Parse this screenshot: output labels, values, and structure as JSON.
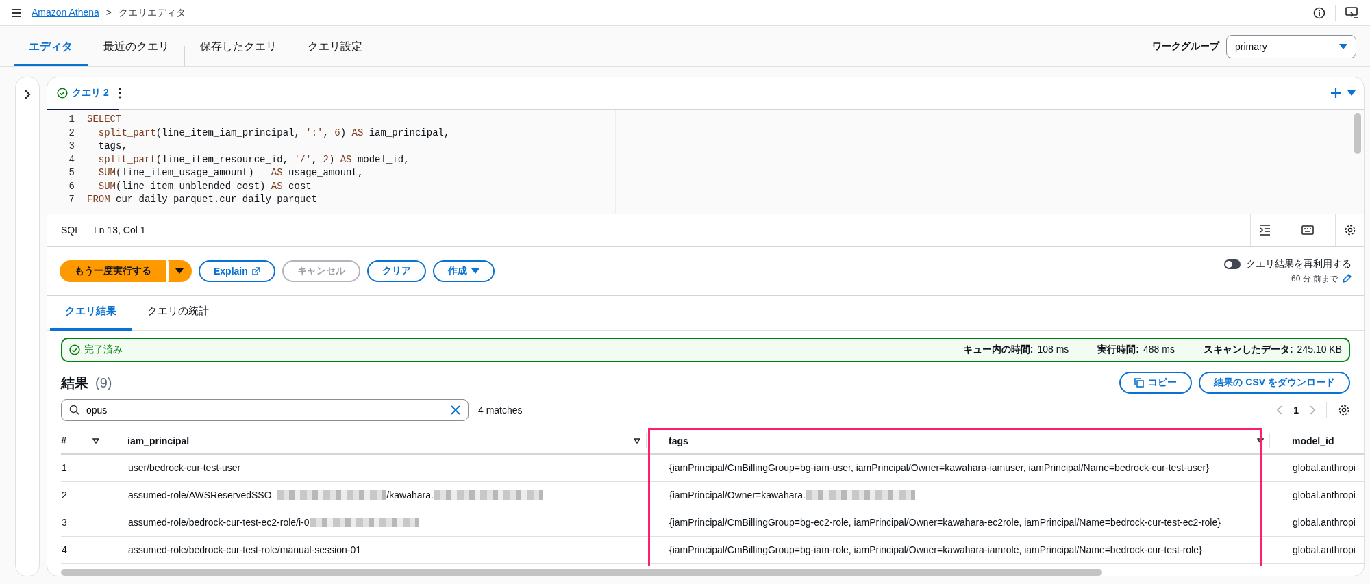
{
  "breadcrumb": {
    "service": "Amazon Athena",
    "separator": ">",
    "page": "クエリエディタ"
  },
  "tabs": [
    {
      "label": "エディタ",
      "selected": true
    },
    {
      "label": "最近のクエリ",
      "selected": false
    },
    {
      "label": "保存したクエリ",
      "selected": false
    },
    {
      "label": "クエリ設定",
      "selected": false
    }
  ],
  "workgroup": {
    "label": "ワークグループ",
    "value": "primary"
  },
  "query_tabs": [
    {
      "label": "クエリ 2",
      "selected": true
    }
  ],
  "editor": {
    "lines": [
      {
        "indented": false,
        "tokens": [
          {
            "kind": "kw",
            "text": "SELECT"
          }
        ]
      },
      {
        "indented": true,
        "tokens": [
          {
            "kind": "kw",
            "text": "split_part"
          },
          {
            "kind": "plain",
            "text": "(line_item_iam_principal, "
          },
          {
            "kind": "str",
            "text": "':'"
          },
          {
            "kind": "plain",
            "text": ", "
          },
          {
            "kind": "num",
            "text": "6"
          },
          {
            "kind": "plain",
            "text": ") "
          },
          {
            "kind": "kw",
            "text": "AS"
          },
          {
            "kind": "plain",
            "text": " iam_principal,"
          }
        ]
      },
      {
        "indented": true,
        "tokens": [
          {
            "kind": "plain",
            "text": "tags,"
          }
        ]
      },
      {
        "indented": true,
        "tokens": [
          {
            "kind": "kw",
            "text": "split_part"
          },
          {
            "kind": "plain",
            "text": "(line_item_resource_id, "
          },
          {
            "kind": "str",
            "text": "'/'"
          },
          {
            "kind": "plain",
            "text": ", "
          },
          {
            "kind": "num",
            "text": "2"
          },
          {
            "kind": "plain",
            "text": ") "
          },
          {
            "kind": "kw",
            "text": "AS"
          },
          {
            "kind": "plain",
            "text": " model_id,"
          }
        ]
      },
      {
        "indented": true,
        "tokens": [
          {
            "kind": "kw",
            "text": "SUM"
          },
          {
            "kind": "plain",
            "text": "(line_item_usage_amount)   "
          },
          {
            "kind": "kw",
            "text": "AS"
          },
          {
            "kind": "plain",
            "text": " usage_amount,"
          }
        ]
      },
      {
        "indented": true,
        "tokens": [
          {
            "kind": "kw",
            "text": "SUM"
          },
          {
            "kind": "plain",
            "text": "(line_item_unblended_cost) "
          },
          {
            "kind": "kw",
            "text": "AS"
          },
          {
            "kind": "plain",
            "text": " cost"
          }
        ]
      },
      {
        "indented": false,
        "tokens": [
          {
            "kind": "kw",
            "text": "FROM"
          },
          {
            "kind": "plain",
            "text": " cur_daily_parquet.cur_daily_parquet"
          }
        ]
      }
    ],
    "line_numbers": [
      "1",
      "2",
      "3",
      "4",
      "5",
      "6",
      "7"
    ],
    "language": "SQL",
    "cursor": "Ln 13, Col 1"
  },
  "actions": [
    {
      "kind": "primary",
      "label": "もう一度実行する",
      "disabled": false
    },
    {
      "kind": "split",
      "disabled": false
    },
    {
      "kind": "external",
      "label": "Explain",
      "disabled": false
    },
    {
      "kind": "normal",
      "label": "キャンセル",
      "disabled": true
    },
    {
      "kind": "normal",
      "label": "クリア",
      "disabled": false
    },
    {
      "kind": "menu",
      "label": "作成",
      "disabled": false
    }
  ],
  "reuse": {
    "label": "クエリ結果を再利用する",
    "on": false,
    "detail": "60 分 前まで"
  },
  "result_tabs": [
    {
      "label": "クエリ結果",
      "selected": true
    },
    {
      "label": "クエリの統計",
      "selected": false
    }
  ],
  "status": {
    "label": "完了済み",
    "stats": [
      {
        "label": "キュー内の時間:",
        "value": "108 ms"
      },
      {
        "label": "実行時間:",
        "value": "488 ms"
      },
      {
        "label": "スキャンしたデータ:",
        "value": "245.10 KB"
      }
    ]
  },
  "results": {
    "title": "結果",
    "count": "(9)",
    "copy": "コピー",
    "download": "結果の CSV をダウンロード",
    "search": "opus",
    "matches": "4 matches",
    "page": "1",
    "columns": [
      {
        "label": "#",
        "highlighted": false
      },
      {
        "label": "iam_principal",
        "highlighted": false
      },
      {
        "label": "tags",
        "highlighted": true
      },
      {
        "label": "model_id",
        "highlighted": false
      }
    ],
    "rows": [
      [
        [
          {
            "text": "1"
          }
        ],
        [
          {
            "text": "user/bedrock-cur-test-user"
          }
        ],
        [
          {
            "text": "{iamPrincipal/CmBillingGroup=bg-iam-user, iamPrincipal/Owner=kawahara-iamuser, iamPrincipal/Name=bedrock-cur-test-user}"
          }
        ],
        [
          {
            "text": "global.anthropi"
          }
        ]
      ],
      [
        [
          {
            "text": "2"
          }
        ],
        [
          {
            "text": "assumed-role/AWSReservedSSO_"
          },
          {
            "kind": "redacted"
          },
          {
            "text": "/kawahara."
          },
          {
            "kind": "redacted"
          }
        ],
        [
          {
            "text": "{iamPrincipal/Owner=kawahara."
          },
          {
            "kind": "redacted"
          }
        ],
        [
          {
            "text": "global.anthropi"
          }
        ]
      ],
      [
        [
          {
            "text": "3"
          }
        ],
        [
          {
            "text": "assumed-role/bedrock-cur-test-ec2-role/i-0"
          },
          {
            "kind": "redacted"
          }
        ],
        [
          {
            "text": "{iamPrincipal/CmBillingGroup=bg-ec2-role, iamPrincipal/Owner=kawahara-ec2role, iamPrincipal/Name=bedrock-cur-test-ec2-role}"
          }
        ],
        [
          {
            "text": "global.anthropi"
          }
        ]
      ],
      [
        [
          {
            "text": "4"
          }
        ],
        [
          {
            "text": "assumed-role/bedrock-cur-test-role/manual-session-01"
          }
        ],
        [
          {
            "text": "{iamPrincipal/CmBillingGroup=bg-iam-role, iamPrincipal/Owner=kawahara-iamrole, iamPrincipal/Name=bedrock-cur-test-role}"
          }
        ],
        [
          {
            "text": "global.anthropi"
          }
        ]
      ]
    ]
  }
}
